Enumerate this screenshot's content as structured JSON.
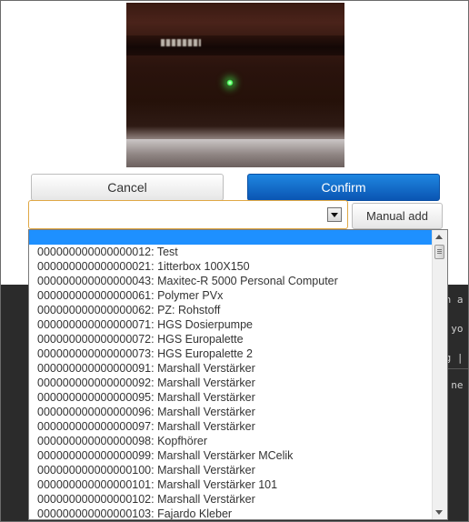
{
  "buttons": {
    "cancel": "Cancel",
    "confirm": "Confirm",
    "manual_add": "Manual add"
  },
  "combo": {
    "value": ""
  },
  "dropdown_items": [
    "000000000000000012: Test",
    "000000000000000021: 1itterbox 100X150",
    "000000000000000043: Maxitec-R 5000 Personal Computer",
    "000000000000000061: Polymer PVx",
    "000000000000000062: PZ: Rohstoff",
    "000000000000000071: HGS Dosierpumpe",
    "000000000000000072: HGS Europalette",
    "000000000000000073: HGS Europalette 2",
    "000000000000000091: Marshall Verstärker",
    "000000000000000092: Marshall Verstärker",
    "000000000000000095: Marshall Verstärker",
    "000000000000000096: Marshall Verstärker",
    "000000000000000097: Marshall Verstärker",
    "000000000000000098: Kopfhörer",
    "000000000000000099: Marshall Verstärker MCelik",
    "000000000000000100: Marshall Verstärker",
    "000000000000000101: Marshall Verstärker 101",
    "000000000000000102: Marshall Verstärker",
    "000000000000000103: Fajardo Kleber"
  ],
  "background_text": [
    "ch a",
    "p yo",
    "pg |",
    "s ne"
  ],
  "colors": {
    "confirm": "#0a62c4",
    "highlight": "#1e90ff",
    "combo_border": "#e0a845"
  }
}
